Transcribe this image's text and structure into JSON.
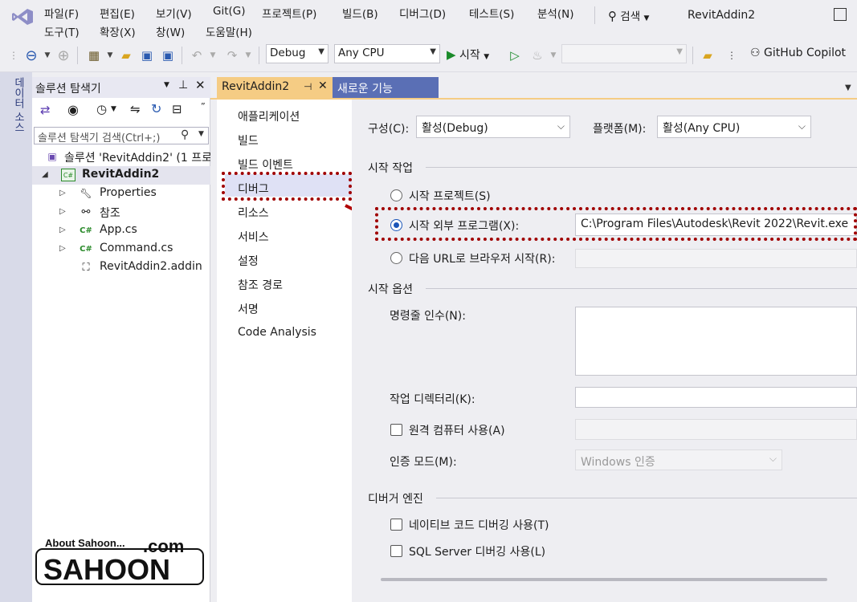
{
  "menu": {
    "row1": [
      "파일(F)",
      "편집(E)",
      "보기(V)",
      "Git(G)",
      "프로젝트(P)",
      "빌드(B)",
      "디버그(D)",
      "테스트(S)",
      "분석(N)"
    ],
    "row2": [
      "도구(T)",
      "확장(X)",
      "창(W)",
      "도움말(H)"
    ],
    "search_label": "검색",
    "app_title": "RevitAddin2"
  },
  "toolbar": {
    "config": "Debug",
    "platform": "Any CPU",
    "start_label": "시작",
    "copilot_label": "GitHub Copilot"
  },
  "left_strip": {
    "tab_label": "데이터 소스"
  },
  "solution_explorer": {
    "title": "솔루션 탐색기",
    "search_placeholder": "솔루션 탐색기 검색(Ctrl+;)",
    "items": [
      {
        "label": "솔루션 'RevitAddin2' (1 프로",
        "icon": "solution-icon"
      },
      {
        "label": "RevitAddin2",
        "icon": "csharp-project-icon"
      },
      {
        "label": "Properties",
        "icon": "wrench-icon"
      },
      {
        "label": "참조",
        "icon": "references-icon"
      },
      {
        "label": "App.cs",
        "icon": "csharp-file-icon"
      },
      {
        "label": "Command.cs",
        "icon": "csharp-file-icon"
      },
      {
        "label": "RevitAddin2.addin",
        "icon": "addin-file-icon"
      }
    ]
  },
  "tabs": {
    "active": "RevitAddin2",
    "other": "새로운 기능"
  },
  "nav": {
    "items": [
      "애플리케이션",
      "빌드",
      "빌드 이벤트",
      "디버그",
      "리소스",
      "서비스",
      "설정",
      "참조 경로",
      "서명",
      "Code Analysis"
    ],
    "selected": "디버그"
  },
  "page": {
    "config_label": "구성(C):",
    "config_value": "활성(Debug)",
    "platform_label": "플랫폼(M):",
    "platform_value": "활성(Any CPU)",
    "start_action_title": "시작 작업",
    "start_project": "시작 프로젝트(S)",
    "start_external": "시작 외부 프로그램(X):",
    "external_path": "C:\\Program Files\\Autodesk\\Revit 2022\\Revit.exe",
    "start_url": "다음 URL로 브라우저 시작(R):",
    "start_options_title": "시작 옵션",
    "cmd_args": "명령줄 인수(N):",
    "working_dir": "작업 디렉터리(K):",
    "remote_machine": "원격 컴퓨터 사용(A)",
    "auth_mode": "인증 모드(M):",
    "auth_value": "Windows 인증",
    "debugger_engines_title": "디버거 엔진",
    "native_debug": "네이티브 코드 디버깅 사용(T)",
    "sql_debug": "SQL Server 디버깅 사용(L)"
  },
  "watermark": {
    "line1": "About Sahoon...",
    "line2": ".com",
    "line3": "SAHOON"
  },
  "colors": {
    "accent": "#1a55b8",
    "tab_active": "#f5cc84",
    "tab_inactive": "#5a6fb5",
    "highlight": "#a00000"
  }
}
